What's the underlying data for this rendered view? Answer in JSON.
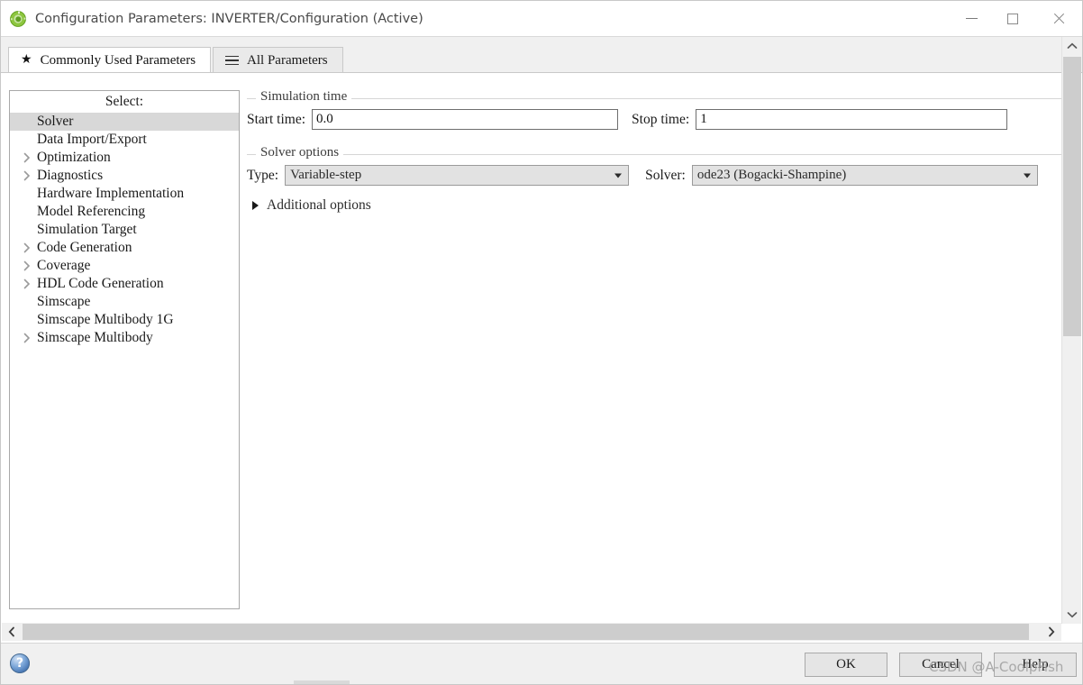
{
  "window": {
    "title": "Configuration Parameters: INVERTER/Configuration (Active)",
    "app_icon": "simulink-icon",
    "minimize_label": "Minimize",
    "maximize_label": "Maximize",
    "close_label": "Close"
  },
  "tabs": [
    {
      "label": "Commonly Used Parameters",
      "icon": "star-icon",
      "active": true
    },
    {
      "label": "All Parameters",
      "icon": "list-icon",
      "active": false
    }
  ],
  "tree": {
    "header": "Select:",
    "items": [
      {
        "label": "Solver",
        "expandable": false,
        "selected": true
      },
      {
        "label": "Data Import/Export",
        "expandable": false,
        "selected": false
      },
      {
        "label": "Optimization",
        "expandable": true,
        "selected": false
      },
      {
        "label": "Diagnostics",
        "expandable": true,
        "selected": false
      },
      {
        "label": "Hardware Implementation",
        "expandable": false,
        "selected": false
      },
      {
        "label": "Model Referencing",
        "expandable": false,
        "selected": false
      },
      {
        "label": "Simulation Target",
        "expandable": false,
        "selected": false
      },
      {
        "label": "Code Generation",
        "expandable": true,
        "selected": false
      },
      {
        "label": "Coverage",
        "expandable": true,
        "selected": false
      },
      {
        "label": "HDL Code Generation",
        "expandable": true,
        "selected": false
      },
      {
        "label": "Simscape",
        "expandable": false,
        "selected": false
      },
      {
        "label": "Simscape Multibody 1G",
        "expandable": false,
        "selected": false
      },
      {
        "label": "Simscape Multibody",
        "expandable": true,
        "selected": false
      }
    ]
  },
  "simulation_time": {
    "legend": "Simulation time",
    "start_label": "Start time:",
    "start_value": "0.0",
    "stop_label": "Stop time:",
    "stop_value": "1"
  },
  "solver_options": {
    "legend": "Solver options",
    "type_label": "Type:",
    "type_value": "Variable-step",
    "solver_label": "Solver:",
    "solver_value": "ode23 (Bogacki-Shampine)"
  },
  "additional_options": {
    "label": "Additional options",
    "expanded": false
  },
  "footer": {
    "help_orb": "?",
    "buttons": [
      {
        "label": "OK",
        "name": "ok-button"
      },
      {
        "label": "Cancel",
        "name": "cancel-button"
      },
      {
        "label": "Help",
        "name": "help-button"
      }
    ]
  },
  "watermark": "CSDN @A-CoolpFish",
  "scrollbars": {
    "vertical_up": "⌃",
    "vertical_down": "⌄",
    "horizontal_left": "‹",
    "horizontal_right": "›"
  },
  "colors": {
    "selection": "#d8d8d8",
    "combo_bg": "#e2e2e2",
    "panel_bg": "#ffffff",
    "chrome_bg": "#f0f0f0",
    "scroll_thumb": "#cdcdcd"
  }
}
